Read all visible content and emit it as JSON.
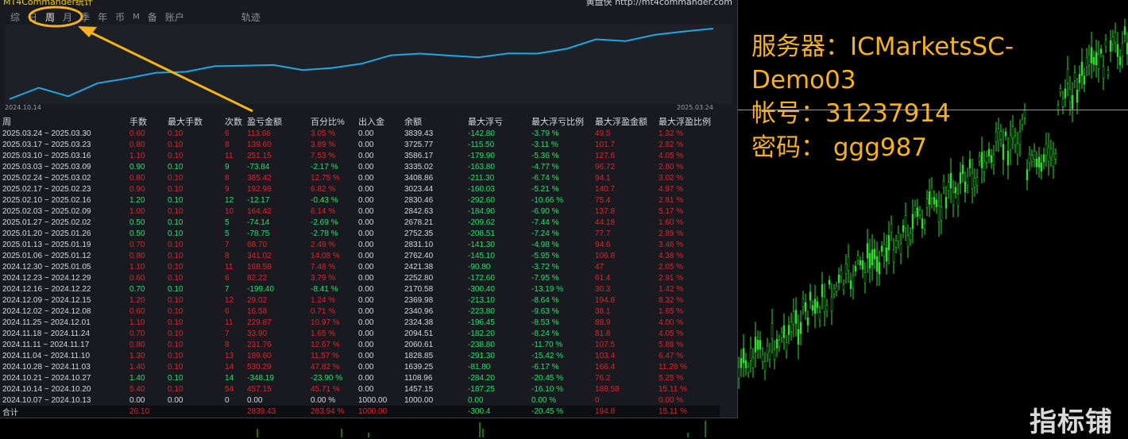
{
  "window": {
    "title": "MT4Commander统计",
    "site": "黄盘侠 http://mt4commander.com"
  },
  "tabs": [
    {
      "label": "综"
    },
    {
      "label": "日"
    },
    {
      "label": "周"
    },
    {
      "label": "月"
    },
    {
      "label": "季"
    },
    {
      "label": "年"
    },
    {
      "label": "币"
    },
    {
      "label": "M"
    },
    {
      "label": "备"
    },
    {
      "label": "账户"
    },
    {
      "label": "轨迹"
    }
  ],
  "equity_chart": {
    "start_label": "2024.10.14",
    "end_label": "2025.03.24",
    "line_color": "#1aa9e6",
    "balance": [
      1000.0,
      1457.15,
      1108.96,
      1639.25,
      1828.85,
      2060.61,
      2094.51,
      2324.38,
      2340.96,
      2369.98,
      2170.58,
      2252.8,
      2421.38,
      2762.4,
      2831.1,
      2752.35,
      2678.21,
      2842.63,
      2830.46,
      3023.44,
      3408.86,
      3335.02,
      3586.17,
      3725.77,
      3839.43
    ]
  },
  "headers": [
    "周",
    "手数",
    "最大手数",
    "次数",
    "盈亏金额",
    "百分比%",
    "出入金",
    "余额",
    "最大浮亏",
    "最大浮亏比例",
    "最大浮盈金额",
    "最大浮盈比例"
  ],
  "rows": [
    [
      "2025.03.24 ~ 2025.03.30",
      "0.60",
      "0.10",
      "6",
      "113.66",
      "3.05 %",
      "0.00",
      "3839.43",
      "-142.80",
      "-3.79 %",
      "49.5",
      "1.32 %"
    ],
    [
      "2025.03.17 ~ 2025.03.23",
      "0.80",
      "0.10",
      "8",
      "139.60",
      "3.89 %",
      "0.00",
      "3725.77",
      "-115.50",
      "-3.11 %",
      "101.7",
      "2.82 %"
    ],
    [
      "2025.03.10 ~ 2025.03.16",
      "1.10",
      "0.10",
      "11",
      "251.15",
      "7.53 %",
      "0.00",
      "3586.17",
      "-179.90",
      "-5.36 %",
      "127.6",
      "4.05 %"
    ],
    [
      "2025.03.03 ~ 2025.03.09",
      "0.90",
      "0.10",
      "9",
      "-73.84",
      "-2.17 %",
      "0.00",
      "3335.02",
      "-163.80",
      "-4.77 %",
      "96.72",
      "2.80 %"
    ],
    [
      "2025.02.24 ~ 2025.03.02",
      "0.80",
      "0.10",
      "8",
      "385.42",
      "12.75 %",
      "0.00",
      "3408.86",
      "-211.30",
      "-6.74 %",
      "94.1",
      "3.02 %"
    ],
    [
      "2025.02.17 ~ 2025.02.23",
      "0.90",
      "0.10",
      "9",
      "192.98",
      "6.82 %",
      "0.00",
      "3023.44",
      "-160.03",
      "-5.21 %",
      "140.7",
      "4.97 %"
    ],
    [
      "2025.02.10 ~ 2025.02.16",
      "1.20",
      "0.10",
      "12",
      "-12.17",
      "-0.43 %",
      "0.00",
      "2830.46",
      "-292.60",
      "-10.66 %",
      "75.4",
      "2.81 %"
    ],
    [
      "2025.02.03 ~ 2025.02.09",
      "1.00",
      "0.10",
      "10",
      "164.42",
      "6.14 %",
      "0.00",
      "2842.63",
      "-184.90",
      "-6.90 %",
      "137.8",
      "5.17 %"
    ],
    [
      "2025.01.27 ~ 2025.02.02",
      "0.50",
      "0.10",
      "5",
      "-74.14",
      "-2.69 %",
      "0.00",
      "2678.21",
      "-209.62",
      "-7.44 %",
      "44.18",
      "1.60 %"
    ],
    [
      "2025.01.20 ~ 2025.01.26",
      "0.50",
      "0.10",
      "5",
      "-78.75",
      "-2.78 %",
      "0.00",
      "2752.35",
      "-208.51",
      "-7.24 %",
      "77.7",
      "2.89 %"
    ],
    [
      "2025.01.13 ~ 2025.01.19",
      "0.70",
      "0.10",
      "7",
      "68.70",
      "2.49 %",
      "0.00",
      "2831.10",
      "-141.30",
      "-4.98 %",
      "94.6",
      "3.46 %"
    ],
    [
      "2025.01.06 ~ 2025.01.12",
      "0.80",
      "0.10",
      "8",
      "341.02",
      "14.08 %",
      "0.00",
      "2762.40",
      "-145.10",
      "-5.95 %",
      "106.8",
      "4.38 %"
    ],
    [
      "2024.12.30 ~ 2025.01.05",
      "1.10",
      "0.10",
      "11",
      "168.58",
      "7.48 %",
      "0.00",
      "2421.38",
      "-90.80",
      "-3.72 %",
      "47",
      "2.05 %"
    ],
    [
      "2024.12.23 ~ 2024.12.29",
      "0.60",
      "0.10",
      "6",
      "82.22",
      "3.79 %",
      "0.00",
      "2252.80",
      "-172.60",
      "-7.95 %",
      "61.4",
      "2.91 %"
    ],
    [
      "2024.12.16 ~ 2024.12.22",
      "0.70",
      "0.10",
      "7",
      "-199.40",
      "-8.41 %",
      "0.00",
      "2170.58",
      "-300.40",
      "-13.19 %",
      "30.3",
      "1.42 %"
    ],
    [
      "2024.12.09 ~ 2024.12.15",
      "1.20",
      "0.10",
      "12",
      "29.02",
      "1.24 %",
      "0.00",
      "2369.98",
      "-213.10",
      "-8.64 %",
      "194.8",
      "8.32 %"
    ],
    [
      "2024.12.02 ~ 2024.12.08",
      "0.60",
      "0.10",
      "6",
      "16.58",
      "0.71 %",
      "0.00",
      "2340.96",
      "-223.80",
      "-9.63 %",
      "38.1",
      "1.65 %"
    ],
    [
      "2024.11.25 ~ 2024.12.01",
      "1.10",
      "0.10",
      "11",
      "229.87",
      "10.97 %",
      "0.00",
      "2324.38",
      "-196.45",
      "-8.53 %",
      "88.9",
      "4.00 %"
    ],
    [
      "2024.11.18 ~ 2024.11.24",
      "0.70",
      "0.10",
      "7",
      "33.90",
      "1.65 %",
      "0.00",
      "2094.51",
      "-182.20",
      "-8.24 %",
      "81.8",
      "4.05 %"
    ],
    [
      "2024.11.11 ~ 2024.11.17",
      "0.80",
      "0.10",
      "8",
      "231.76",
      "12.67 %",
      "0.00",
      "2060.61",
      "-238.80",
      "-11.70 %",
      "107.5",
      "5.88 %"
    ],
    [
      "2024.11.04 ~ 2024.11.10",
      "1.30",
      "0.10",
      "13",
      "189.60",
      "11.57 %",
      "0.00",
      "1828.85",
      "-291.30",
      "-15.42 %",
      "103.4",
      "6.47 %"
    ],
    [
      "2024.10.28 ~ 2024.11.03",
      "1.40",
      "0.10",
      "14",
      "530.29",
      "47.82 %",
      "0.00",
      "1639.25",
      "-81.80",
      "-6.17 %",
      "166.4",
      "11.28 %"
    ],
    [
      "2024.10.21 ~ 2024.10.27",
      "1.40",
      "0.10",
      "14",
      "-348.19",
      "-23.90 %",
      "0.00",
      "1108.96",
      "-284.20",
      "-20.45 %",
      "76.2",
      "5.25 %"
    ],
    [
      "2024.10.14 ~ 2024.10.20",
      "5.40",
      "0.10",
      "54",
      "457.15",
      "45.71 %",
      "0.00",
      "1457.15",
      "-187.25",
      "-16.10 %",
      "188.58",
      "15.11 %"
    ],
    [
      "2024.10.07 ~ 2024.10.13",
      "0.00",
      "0.00",
      "0",
      "0.00",
      "0.00 %",
      "1000.00",
      "1000.00",
      "0.00",
      "0.00 %",
      "0",
      "0.00 %"
    ]
  ],
  "total": [
    "合计",
    "26.10",
    "",
    "",
    "2839.43",
    "283.94 %",
    "1000.00",
    "",
    "-300.4",
    "-20.45 %",
    "194.8",
    "15.11 %"
  ],
  "info": {
    "server": "服务器：ICMarketsSC-",
    "server2": "Demo03",
    "account": "帐号：31237914",
    "password": "密码： ggg987"
  },
  "watermark": "指标铺",
  "colors": {
    "profit": "#e0232b",
    "loss": "#22e06c",
    "candle": "#2fdc2f",
    "annotation": "#f5b21a"
  }
}
